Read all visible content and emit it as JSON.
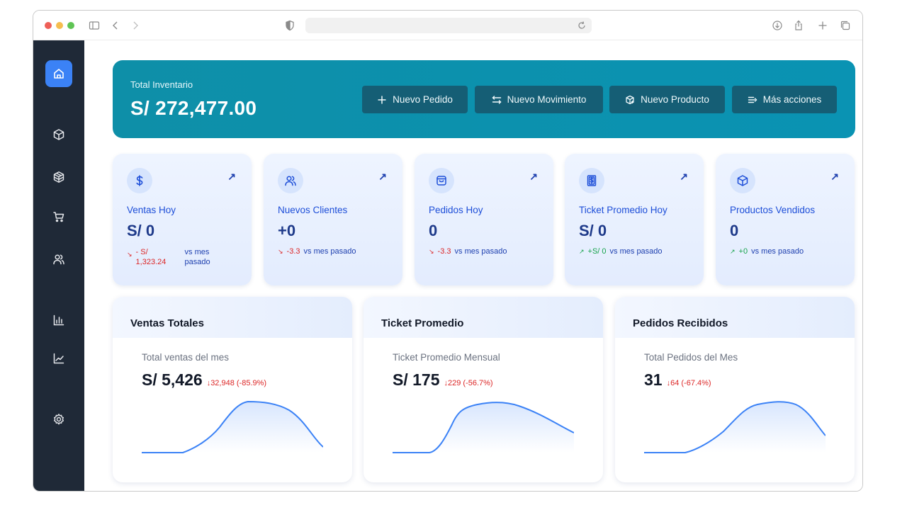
{
  "browser": {
    "traffic_colors": [
      "#ee5f57",
      "#f5bd4f",
      "#5fc454"
    ]
  },
  "sidebar": {
    "items": [
      {
        "icon": "home-icon",
        "active": true
      },
      {
        "icon": "box-icon"
      },
      {
        "icon": "boxes-icon"
      },
      {
        "icon": "cart-icon"
      },
      {
        "icon": "users-icon"
      },
      {
        "icon": "bar-chart-icon"
      },
      {
        "icon": "line-chart-icon"
      },
      {
        "icon": "settings-icon"
      }
    ]
  },
  "hero": {
    "label": "Total Inventario",
    "value": "S/ 272,477.00",
    "buttons": [
      {
        "label": "Nuevo Pedido",
        "icon": "plus-icon"
      },
      {
        "label": "Nuevo Movimiento",
        "icon": "swap-icon"
      },
      {
        "label": "Nuevo Producto",
        "icon": "package-plus-icon"
      },
      {
        "label": "Más acciones",
        "icon": "list-arrow-icon"
      }
    ]
  },
  "kpis": [
    {
      "title": "Ventas Hoy",
      "value": "S/ 0",
      "trend_dir": "down",
      "trend_arrow": "↘",
      "trend_value": "- S/ 1,323.24",
      "trend_suffix": "vs mes pasado",
      "icon": "dollar-icon",
      "link_arrow": "↗"
    },
    {
      "title": "Nuevos Clientes",
      "value": "+0",
      "trend_dir": "down",
      "trend_arrow": "↘",
      "trend_value": "-3.3",
      "trend_suffix": "vs mes pasado",
      "icon": "users-icon",
      "link_arrow": "↗"
    },
    {
      "title": "Pedidos Hoy",
      "value": "0",
      "trend_dir": "down",
      "trend_arrow": "↘",
      "trend_value": "-3.3",
      "trend_suffix": "vs mes pasado",
      "icon": "bag-icon",
      "link_arrow": "↗"
    },
    {
      "title": "Ticket Promedio Hoy",
      "value": "S/ 0",
      "trend_dir": "up",
      "trend_arrow": "↗",
      "trend_value": "+S/ 0",
      "trend_suffix": "vs mes pasado",
      "icon": "receipt-icon",
      "link_arrow": "↗"
    },
    {
      "title": "Productos Vendidos",
      "value": "0",
      "trend_dir": "up",
      "trend_arrow": "↗",
      "trend_value": "+0",
      "trend_suffix": "vs mes pasado",
      "icon": "box-icon",
      "link_arrow": "↗"
    }
  ],
  "cards": [
    {
      "title": "Ventas Totales",
      "subtitle": "Total ventas del mes",
      "value": "S/ 5,426",
      "delta": "↓32,948 (-85.9%)"
    },
    {
      "title": "Ticket Promedio",
      "subtitle": "Ticket Promedio Mensual",
      "value": "S/ 175",
      "delta": "↓229 (-56.7%)"
    },
    {
      "title": "Pedidos Recibidos",
      "subtitle": "Total Pedidos del Mes",
      "value": "31",
      "delta": "↓64 (-67.4%)"
    }
  ],
  "colors": {
    "accent": "#3b82f6",
    "hero_bg": "#0a93b3",
    "hero_button": "#155e75",
    "sidebar_bg": "#1f2937",
    "trend_down": "#dc2626",
    "trend_up": "#16a34a",
    "sparkline": "#3b82f6"
  }
}
